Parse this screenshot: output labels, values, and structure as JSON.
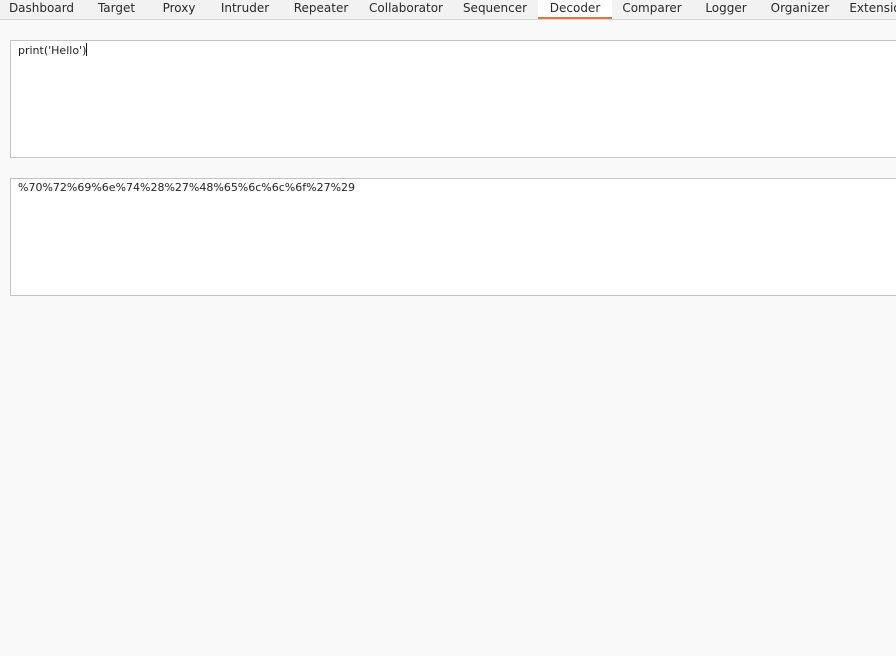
{
  "tabs": [
    {
      "label": "Dashboard"
    },
    {
      "label": "Target"
    },
    {
      "label": "Proxy"
    },
    {
      "label": "Intruder"
    },
    {
      "label": "Repeater"
    },
    {
      "label": "Collaborator"
    },
    {
      "label": "Sequencer"
    },
    {
      "label": "Decoder",
      "active": true
    },
    {
      "label": "Comparer"
    },
    {
      "label": "Logger"
    },
    {
      "label": "Organizer"
    },
    {
      "label": "Extensio"
    }
  ],
  "decoder": {
    "input_text": "print('Hello')",
    "output_text": "%70%72%69%6e%74%28%27%48%65%6c%6c%6f%27%29"
  },
  "colors": {
    "active_tab_underline": "#e8743b",
    "background": "#f9f9f9",
    "editor_background": "#ffffff"
  }
}
